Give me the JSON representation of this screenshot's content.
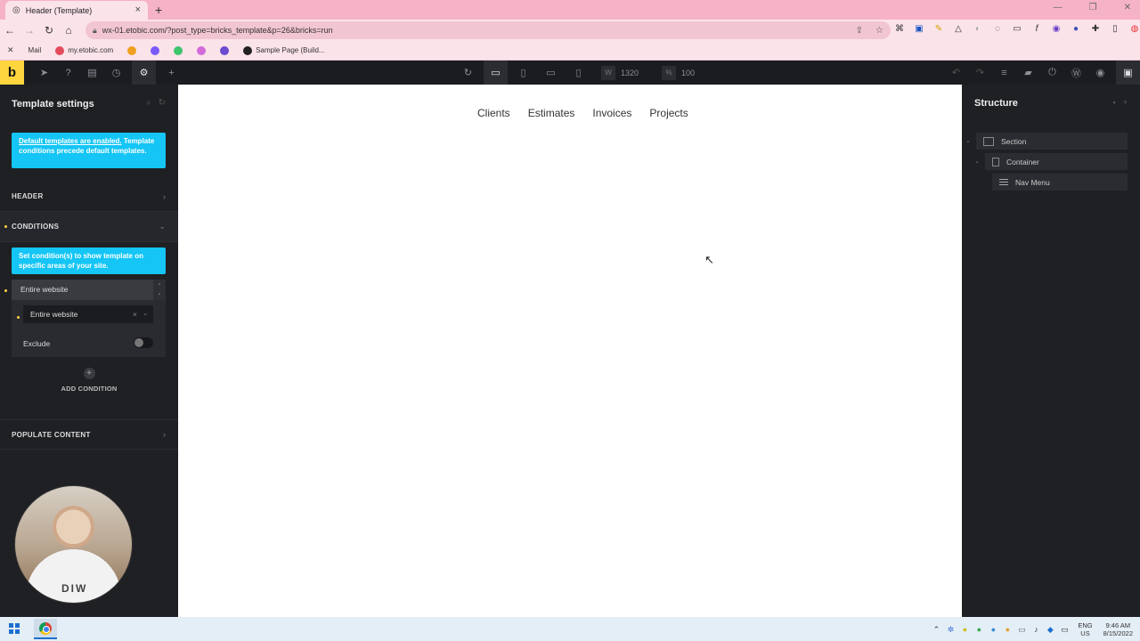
{
  "browser": {
    "tab_title": "Header (Template)",
    "url": "wx-01.etobic.com/?post_type=bricks_template&p=26&bricks=run",
    "bookmarks": [
      "Mail",
      "my.etobic.com",
      "Sample Page (Build..."
    ]
  },
  "toolbar": {
    "logo": "b",
    "width_label": "W",
    "width_value": "1320",
    "zoom_label": "%",
    "zoom_value": "100"
  },
  "left_panel": {
    "title": "Template settings",
    "notice_link": "Default templates are enabled.",
    "notice_text": "Template conditions precede default templates.",
    "header_label": "HEADER",
    "conditions_label": "CONDITIONS",
    "conditions_hint": "Set condition(s) to show template on specific areas of your site.",
    "condition_title": "Entire website",
    "condition_value": "Entire website",
    "exclude_label": "Exclude",
    "add_condition": "ADD CONDITION",
    "populate_label": "POPULATE CONTENT"
  },
  "canvas": {
    "nav_items": [
      "Clients",
      "Estimates",
      "Invoices",
      "Projects"
    ]
  },
  "right_panel": {
    "title": "Structure",
    "items": [
      "Section",
      "Container",
      "Nav Menu"
    ]
  },
  "taskbar": {
    "lang_top": "ENG",
    "lang_bottom": "US",
    "time": "9:46 AM",
    "date": "8/15/2022"
  },
  "colors": {
    "brand": "#ffd53e",
    "info": "#14c5f5",
    "chrome_tab": "#f6b2c6"
  }
}
